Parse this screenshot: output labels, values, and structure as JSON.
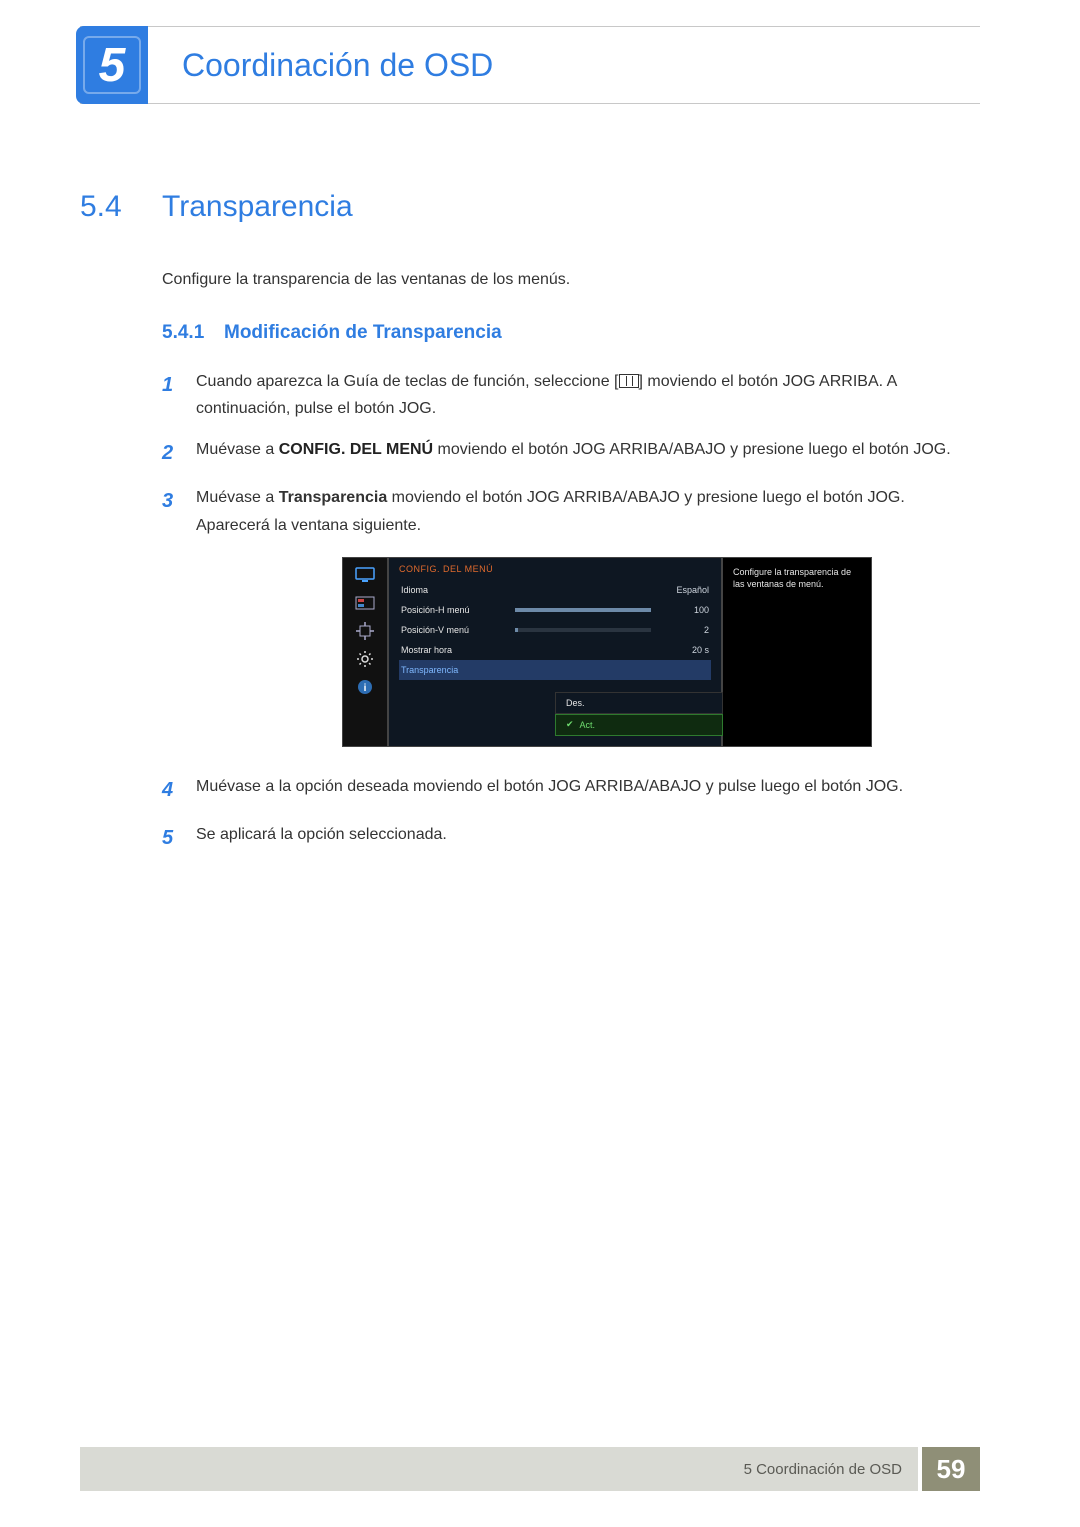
{
  "chapter": {
    "number": "5",
    "title": "Coordinación de OSD"
  },
  "section": {
    "number": "5.4",
    "title": "Transparencia",
    "intro": "Configure la transparencia de las ventanas de los menús."
  },
  "subsection": {
    "number": "5.4.1",
    "title": "Modificación de Transparencia"
  },
  "steps": {
    "s1": {
      "num": "1",
      "pre": "Cuando aparezca la Guía de teclas de función, seleccione [",
      "post": "] moviendo el botón JOG ARRIBA. A continuación, pulse el botón JOG."
    },
    "s2": {
      "num": "2",
      "pre": "Muévase a ",
      "strong": "CONFIG. DEL MENÚ",
      "post": " moviendo el botón JOG ARRIBA/ABAJO y presione luego el botón JOG."
    },
    "s3": {
      "num": "3",
      "pre": "Muévase a ",
      "strong": "Transparencia",
      "post": " moviendo el botón JOG ARRIBA/ABAJO y presione luego el botón JOG.",
      "next": "Aparecerá la ventana siguiente."
    },
    "s4": {
      "num": "4",
      "text": "Muévase a la opción deseada moviendo el botón JOG ARRIBA/ABAJO y pulse luego el botón JOG."
    },
    "s5": {
      "num": "5",
      "text": "Se aplicará la opción seleccionada."
    }
  },
  "osd": {
    "header": "CONFIG. DEL MENÚ",
    "rows": {
      "idioma": {
        "label": "Idioma",
        "value": "Español"
      },
      "posh": {
        "label": "Posición-H menú",
        "value": "100",
        "fill": 100
      },
      "posv": {
        "label": "Posición-V menú",
        "value": "2",
        "fill": 2
      },
      "mostrar": {
        "label": "Mostrar hora",
        "value": "20 s"
      },
      "transp": {
        "label": "Transparencia"
      }
    },
    "options": {
      "off": "Des.",
      "on": "Act."
    },
    "help": "Configure la transparencia de las ventanas de menú."
  },
  "footer": {
    "text": "5 Coordinación de OSD",
    "page": "59"
  }
}
